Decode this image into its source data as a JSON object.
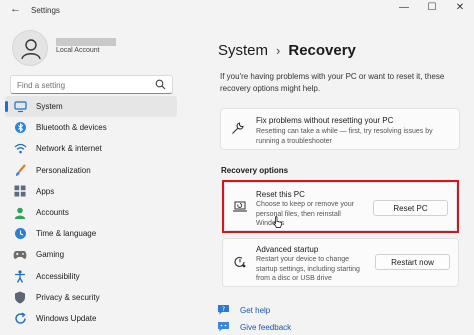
{
  "window": {
    "title": "Settings"
  },
  "profile": {
    "account_type": "Local Account"
  },
  "search": {
    "placeholder": "Find a setting"
  },
  "sidebar": {
    "items": [
      {
        "label": "System",
        "icon": "monitor-icon",
        "active": true
      },
      {
        "label": "Bluetooth & devices",
        "icon": "bluetooth-icon"
      },
      {
        "label": "Network & internet",
        "icon": "wifi-icon"
      },
      {
        "label": "Personalization",
        "icon": "brush-icon"
      },
      {
        "label": "Apps",
        "icon": "apps-icon"
      },
      {
        "label": "Accounts",
        "icon": "person-icon"
      },
      {
        "label": "Time & language",
        "icon": "globe-clock-icon"
      },
      {
        "label": "Gaming",
        "icon": "gamepad-icon"
      },
      {
        "label": "Accessibility",
        "icon": "accessibility-icon"
      },
      {
        "label": "Privacy & security",
        "icon": "shield-icon"
      },
      {
        "label": "Windows Update",
        "icon": "refresh-icon"
      }
    ]
  },
  "breadcrumb": {
    "parent": "System",
    "separator": "›",
    "current": "Recovery"
  },
  "intro_text": "If you're having problems with your PC or want to reset it, these recovery options might help.",
  "fix_card": {
    "title": "Fix problems without resetting your PC",
    "description": "Resetting can take a while — first, try resolving issues by running a troubleshooter"
  },
  "recovery_options": {
    "heading": "Recovery options",
    "reset": {
      "title": "Reset this PC",
      "description": "Choose to keep or remove your personal files, then reinstall Windows",
      "button": "Reset PC"
    },
    "advanced": {
      "title": "Advanced startup",
      "description": "Restart your device to change startup settings, including starting from a disc or USB drive",
      "button": "Restart now"
    }
  },
  "links": {
    "help": "Get help",
    "feedback": "Give feedback"
  },
  "colors": {
    "accent": "#1a73c8",
    "highlight_border": "#d4151c",
    "link": "#1a57a8"
  }
}
